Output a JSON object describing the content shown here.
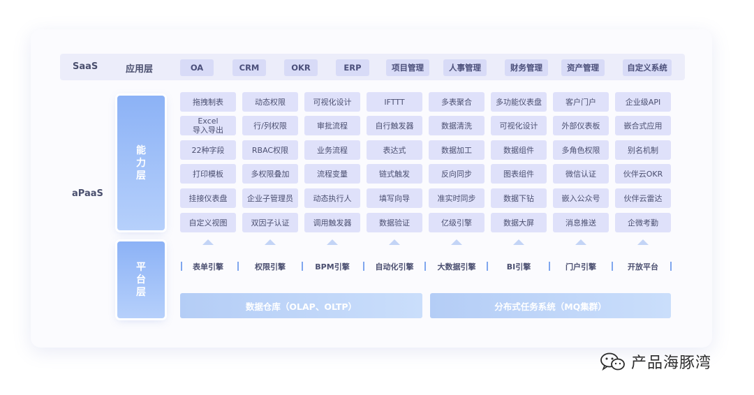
{
  "saas": {
    "label": "SaaS",
    "layer_label": "应用层",
    "items": [
      "OA",
      "CRM",
      "OKR",
      "ERP",
      "项目管理",
      "人事管理",
      "财务管理",
      "资产管理",
      "自定义系统"
    ]
  },
  "apaas": {
    "label": "aPaaS",
    "capability_layer": "能力层",
    "platform_layer": "平台层",
    "capabilities": [
      [
        "拖拽制表",
        "Excel\n导入导出",
        "22种字段",
        "打印模板",
        "挂接仪表盘",
        "自定义视图"
      ],
      [
        "动态权限",
        "行/列权限",
        "RBAC权限",
        "多权限叠加",
        "企业子管理员",
        "双因子认证"
      ],
      [
        "可视化设计",
        "审批流程",
        "业务流程",
        "流程变量",
        "动态执行人",
        "调用触发器"
      ],
      [
        "IFTTT",
        "自行触发器",
        "表达式",
        "链式触发",
        "填写向导",
        "数据验证"
      ],
      [
        "多表聚合",
        "数据清洗",
        "数据加工",
        "反向同步",
        "准实时同步",
        "亿级引擎"
      ],
      [
        "多功能仪表盘",
        "可视化设计",
        "数据组件",
        "图表组件",
        "数据下钻",
        "数据大屏"
      ],
      [
        "客户门户",
        "外部仪表板",
        "多角色权限",
        "微信认证",
        "嵌入公众号",
        "消息推送"
      ],
      [
        "企业级API",
        "嵌合式应用",
        "别名机制",
        "伙伴云OKR",
        "伙伴云雷达",
        "企微考勤"
      ]
    ],
    "engines": [
      "表单引擎",
      "权限引擎",
      "BPM引擎",
      "自动化引擎",
      "大数据引擎",
      "BI引擎",
      "门户引擎",
      "开放平台"
    ],
    "base": [
      "数据仓库（OLAP、OLTP）",
      "分布式任务系统（MQ集群）"
    ]
  },
  "watermark": {
    "text": "产品海豚湾",
    "icon": "wechat-icon"
  },
  "colors": {
    "cell_bg": "#dfe1fa",
    "layer_blue": "#8cb2f6",
    "base_bar": "#b4cdf6",
    "text": "#4b4f70"
  }
}
